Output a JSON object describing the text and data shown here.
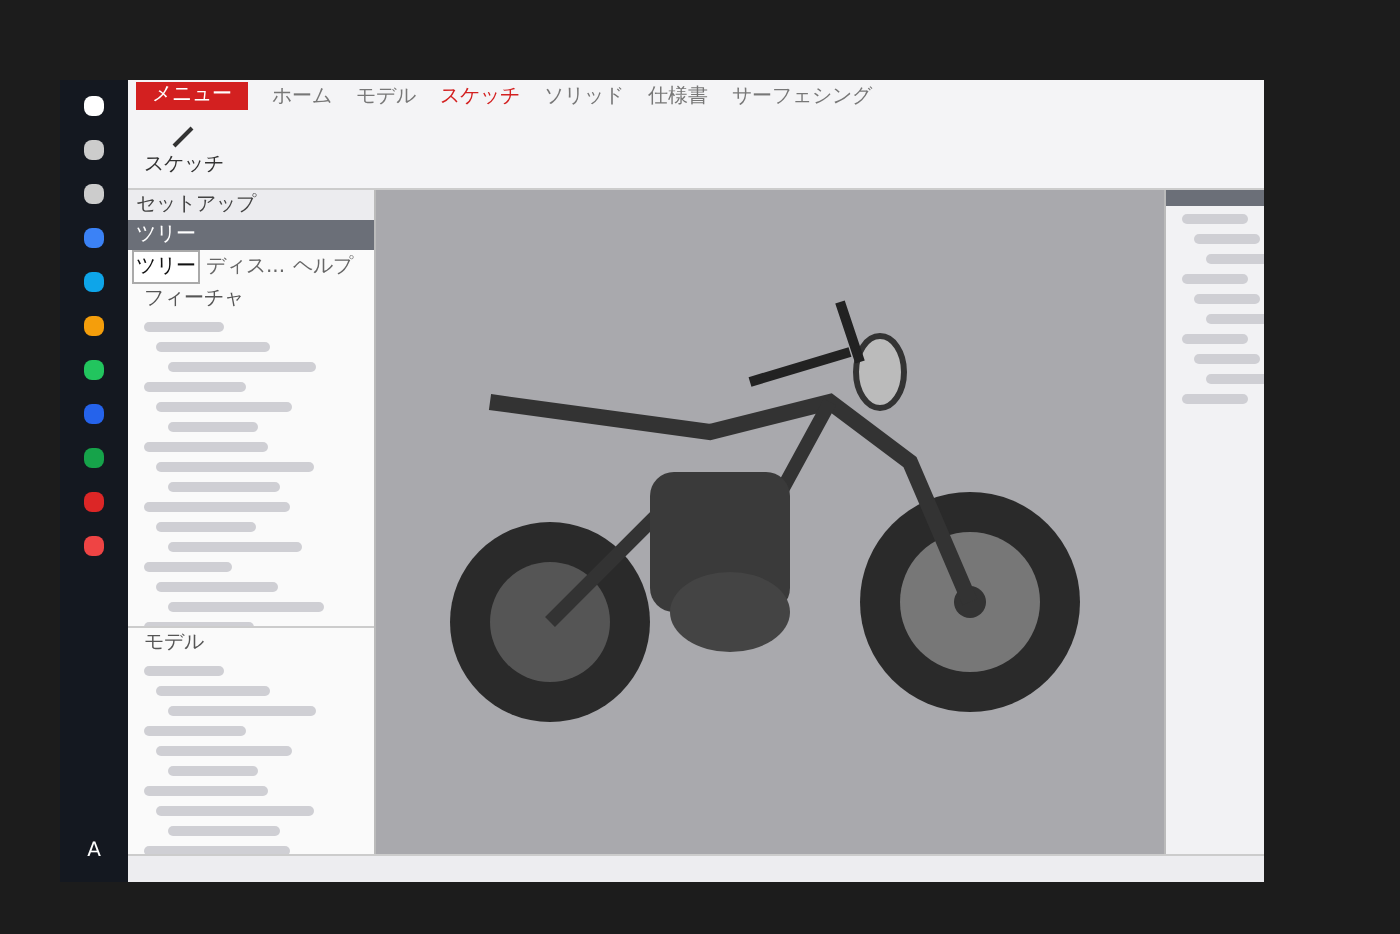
{
  "ribbon": {
    "menu_button": "メニュー",
    "tabs": [
      {
        "label": "ホーム",
        "selected": false
      },
      {
        "label": "モデル",
        "selected": false
      },
      {
        "label": "スケッチ",
        "selected": true
      },
      {
        "label": "ソリッド",
        "selected": false
      },
      {
        "label": "仕様書",
        "selected": false
      },
      {
        "label": "サーフェシング",
        "selected": false
      }
    ],
    "tools": [
      {
        "label": "スケッチ"
      }
    ]
  },
  "setup_bar": "セットアップ",
  "tree_panel": {
    "title": "ツリー",
    "tabs": [
      {
        "label": "ツリー",
        "selected": true
      },
      {
        "label": "ディス...",
        "selected": false
      },
      {
        "label": "ヘルプ",
        "selected": false
      }
    ],
    "root": "フィーチャ",
    "section": "モデル"
  },
  "taskbar": {
    "language": "A"
  }
}
